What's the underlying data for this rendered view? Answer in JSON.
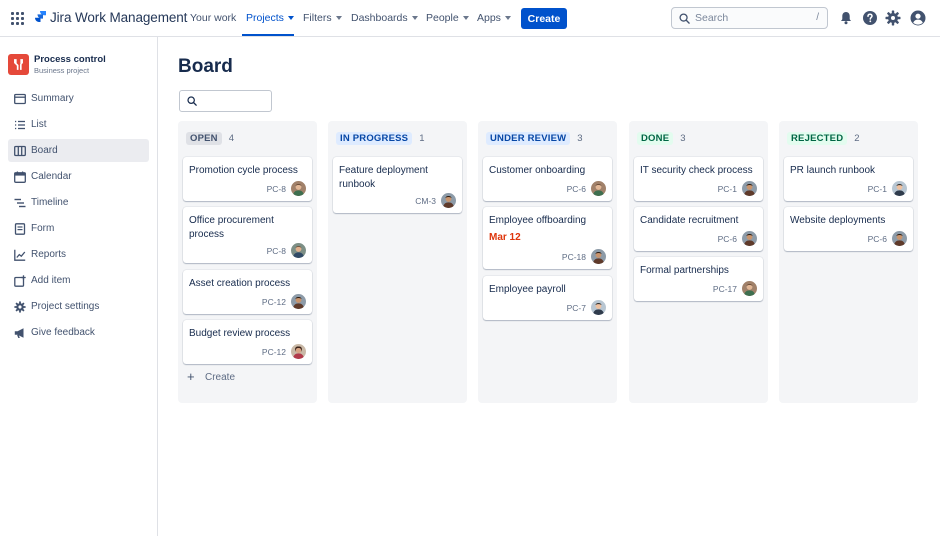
{
  "topnav": {
    "brand": "Jira Work Management",
    "items": [
      {
        "label": "Your work"
      },
      {
        "label": "Projects"
      },
      {
        "label": "Filters"
      },
      {
        "label": "Dashboards"
      },
      {
        "label": "People"
      },
      {
        "label": "Apps"
      }
    ],
    "active_item": "Projects",
    "create_label": "Create",
    "search_placeholder": "Search",
    "search_shortcut": "/",
    "accent_color": "#0052cc"
  },
  "sidebar": {
    "project_name": "Process control",
    "project_type": "Business project",
    "items": [
      {
        "label": "Summary",
        "icon": "summary-icon"
      },
      {
        "label": "List",
        "icon": "list-icon"
      },
      {
        "label": "Board",
        "icon": "board-icon"
      },
      {
        "label": "Calendar",
        "icon": "calendar-icon"
      },
      {
        "label": "Timeline",
        "icon": "timeline-icon"
      },
      {
        "label": "Form",
        "icon": "form-icon"
      },
      {
        "label": "Reports",
        "icon": "reports-icon"
      },
      {
        "label": "Add item",
        "icon": "add-item-icon"
      },
      {
        "label": "Project settings",
        "icon": "gear-icon"
      },
      {
        "label": "Give feedback",
        "icon": "megaphone-icon"
      }
    ],
    "active_item": "Board"
  },
  "board": {
    "title": "Board",
    "search_placeholder": "",
    "create_label": "Create",
    "columns": [
      {
        "name": "OPEN",
        "count": "4",
        "lozenge_bg": "#dfe1e6",
        "lozenge_fg": "#42526e",
        "cards": [
          {
            "title": "Promotion cycle process",
            "key": "PC-8"
          },
          {
            "title": "Office procurement process",
            "key": "PC-8"
          },
          {
            "title": "Asset creation process",
            "key": "PC-12"
          },
          {
            "title": "Budget review process",
            "key": "PC-12"
          }
        ]
      },
      {
        "name": "IN PROGRESS",
        "count": "1",
        "lozenge_bg": "#deebff",
        "lozenge_fg": "#0747a6",
        "cards": [
          {
            "title": "Feature deployment runbook",
            "key": "CM-3"
          }
        ]
      },
      {
        "name": "UNDER REVIEW",
        "count": "3",
        "lozenge_bg": "#deebff",
        "lozenge_fg": "#0747a6",
        "cards": [
          {
            "title": "Customer onboarding",
            "key": "PC-6"
          },
          {
            "title": "Employee offboarding",
            "key": "PC-18",
            "due": "Mar 12"
          },
          {
            "title": "Employee payroll",
            "key": "PC-7"
          }
        ]
      },
      {
        "name": "DONE",
        "count": "3",
        "lozenge_bg": "#e3fcef",
        "lozenge_fg": "#006644",
        "cards": [
          {
            "title": "IT security check process",
            "key": "PC-1"
          },
          {
            "title": "Candidate recruitment",
            "key": "PC-6"
          },
          {
            "title": "Formal partnerships",
            "key": "PC-17"
          }
        ]
      },
      {
        "name": "REJECTED",
        "count": "2",
        "lozenge_bg": "#e3fcef",
        "lozenge_fg": "#006644",
        "cards": [
          {
            "title": "PR launch runbook",
            "key": "PC-1"
          },
          {
            "title": "Website deployments",
            "key": "PC-6"
          }
        ]
      }
    ]
  }
}
